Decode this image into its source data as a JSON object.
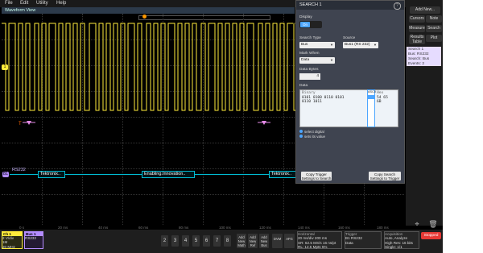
{
  "menu": [
    "File",
    "Edit",
    "Utility",
    "Help"
  ],
  "waveform_view": {
    "title": "Waveform View"
  },
  "channel1_marker": "1",
  "bus_marker": "B1",
  "bus_label": "RS232",
  "decode_packets": [
    "Tektronix..",
    "Enabling.Innovation..",
    "Tektronix.."
  ],
  "time_axis": [
    "0 s",
    "20 ms",
    "40 ms",
    "60 ms",
    "80 ms",
    "100 ms",
    "120 ms",
    "140 ms",
    "160 ms",
    "180 ms"
  ],
  "search_dialog": {
    "title": "SEARCH 1",
    "display_label": "Display",
    "display_value": "On",
    "search_type_label": "Search Type",
    "search_type": "Bus",
    "source_label": "Source",
    "source": "Bus1 (RS 232)",
    "mark_when_label": "Mark When",
    "mark_when": "Data",
    "data_bytes_label": "Data Bytes",
    "data_bytes": "4",
    "data_label": "Data",
    "binary_label": "Binary",
    "binary_lines": [
      "0101 0100 0110 0101",
      "0110 1011"
    ],
    "hex_label": "Hex",
    "hex_lines": [
      "54 65",
      "6B"
    ],
    "ascii_label": "ASCII",
    "legend_select": "select digital",
    "legend_set": "sets its value",
    "btn_copy_trigger": "Copy Trigger Settings to Search",
    "btn_copy_search": "Copy Search Settings to Trigger"
  },
  "right_panel": {
    "add_new": "Add New...",
    "cursors": "Cursors",
    "note": "Note",
    "measure": "Measure",
    "search": "Search",
    "results_table": "Results Table",
    "plot": "Plot",
    "search_badge": [
      "Search 1",
      "Bus: RS232",
      "Search: Bus",
      "Events: 2"
    ]
  },
  "bottom": {
    "ch1": {
      "label": "Ch 1",
      "lines": [
        "2 V/div",
        "1M",
        "20 MHz"
      ]
    },
    "bus1": {
      "label": "Bus 1",
      "lines": [
        "RS232"
      ]
    },
    "channel_buttons": [
      "2",
      "3",
      "4",
      "5",
      "6",
      "7",
      "8"
    ],
    "add_math": "Add New Math",
    "add_ref": "Add New Ref",
    "add_bus": "Add New Bus",
    "dvm": "DVM",
    "afg": "AFG",
    "horizontal": {
      "label": "Horizontal",
      "lines": [
        "20 ms/div   200 ms",
        "SR: 62.5 MS/s   16 ns/pt",
        "RL: 12.5 Mpts   5%"
      ]
    },
    "trigger": {
      "label": "Trigger",
      "lines": [
        "B1   RS232",
        "Data"
      ]
    },
    "acquisition": {
      "label": "Acquisition",
      "lines": [
        "Auto,   Analyze",
        "High Res: 16 bits",
        "Single: 1/1"
      ]
    },
    "stop": "Stopped"
  },
  "colors": {
    "ch1": "#ffeb3b",
    "bus": "#b48cff",
    "decode": "#00bcd4",
    "stop": "#e53935"
  }
}
